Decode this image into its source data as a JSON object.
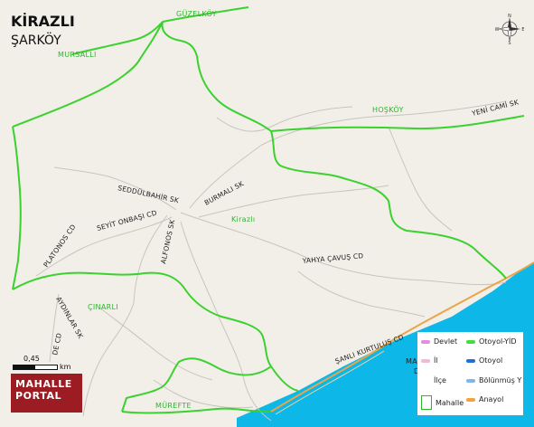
{
  "title": "KİRAZLI",
  "subtitle": "ŞARKÖY",
  "places": {
    "guzelkoy": "GÜZELKÖY",
    "mursalli": "MURSALLI",
    "hoskoy": "HOŞKÖY",
    "kirazli": "Kirazlı",
    "cinarli": "ÇINARLI",
    "murefte": "MÜREFTE",
    "mahalle_partial_1": "MA",
    "mahalle_partial_2": "D"
  },
  "streets": {
    "yeni_cami": "YENİ CAMİ SK",
    "seddulbahir": "SEDDÜLBAHİR SK",
    "burmali": "BURMALI SK",
    "seyit_onbasi": "SEYİT ONBAŞI CD",
    "alfonos": "ALFONOS SK",
    "platonos": "PLATONOS CD",
    "yahya_cavus": "YAHYA ÇAVUŞ CD",
    "aydinlar": "AYDINLAR SK",
    "sanli_kurtulus": "ŞANLI KURTULUŞ CD",
    "partial_cd": "DE CD"
  },
  "scale": {
    "value": "0,45",
    "unit": "km"
  },
  "logo": {
    "line1": "MAHALLE",
    "line2": "PORTAL"
  },
  "legend": {
    "items": [
      {
        "label": "Devlet",
        "color": "#e38ce0"
      },
      {
        "label": "Otoyol-YİD",
        "color": "#3ee03e"
      },
      {
        "label": "İl",
        "color": "#f2b8d8"
      },
      {
        "label": "Otoyol",
        "color": "#1e6fd9"
      },
      {
        "label": "İlçe",
        "color": ""
      },
      {
        "label": "Bölünmüş Y",
        "color": "#7fb6e8"
      },
      {
        "label": "Mahalle",
        "color": "#2fb52f"
      },
      {
        "label": "Anayol",
        "color": "#f2a33a"
      }
    ]
  },
  "compass": {
    "n": "N",
    "s": "S",
    "e": "E",
    "w": "W"
  },
  "colors": {
    "land": "#f2efe9",
    "sea": "#0db8e8",
    "boundary": "#3bd12e",
    "road": "#c8c4bd",
    "main_road": "#e8a54a"
  }
}
